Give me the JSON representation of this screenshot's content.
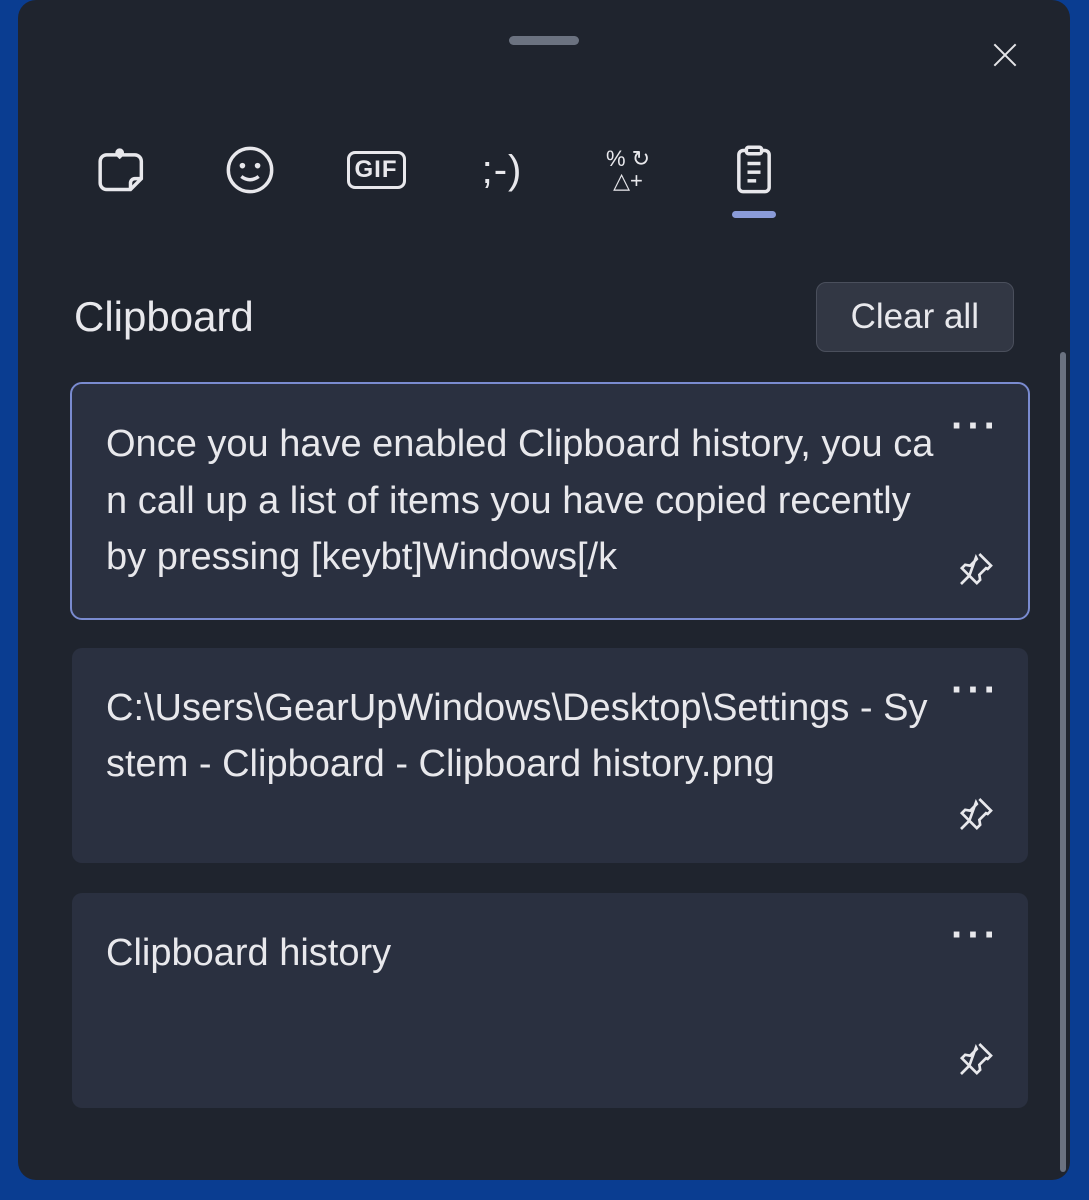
{
  "panel": {
    "title": "Clipboard",
    "clear_all": "Clear all"
  },
  "tabs": [
    {
      "name": "favorites"
    },
    {
      "name": "emoji"
    },
    {
      "name": "gif",
      "label": "GIF"
    },
    {
      "name": "kaomoji",
      "label": ";-)"
    },
    {
      "name": "symbols",
      "label_top": "% ↻",
      "label_bottom": "△+"
    },
    {
      "name": "clipboard",
      "active": true
    }
  ],
  "clips": [
    {
      "text": "Once you have enabled Clipboard history, you can call up a list of items you have copied recently by pressing [keybt]Windows[/k",
      "selected": true
    },
    {
      "text": "C:\\Users\\GearUpWindows\\Desktop\\Settings - System - Clipboard - Clipboard history.png",
      "selected": false
    },
    {
      "text": "Clipboard history",
      "selected": false
    }
  ]
}
